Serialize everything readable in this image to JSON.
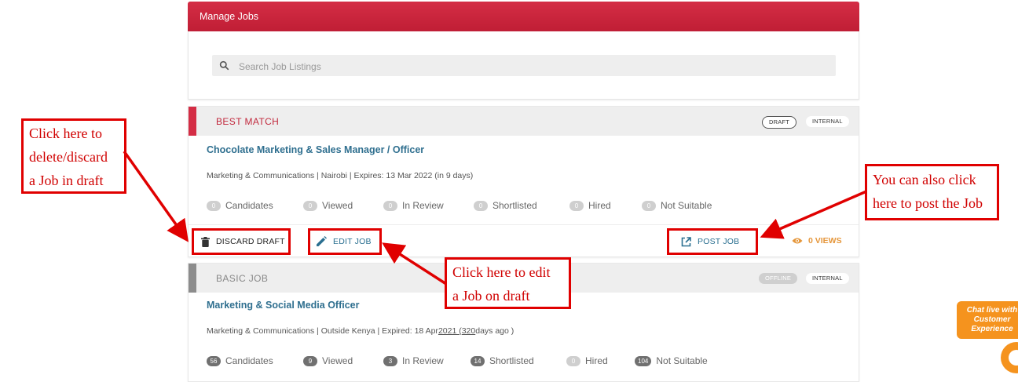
{
  "header": {
    "title": "Manage Jobs"
  },
  "search": {
    "placeholder": "Search Job Listings"
  },
  "jobs": [
    {
      "type": "BEST MATCH",
      "tags": [
        "DRAFT",
        "INTERNAL"
      ],
      "title": "Chocolate Marketing & Sales Manager / Officer",
      "meta": "Marketing & Communications | Nairobi | Expires: 13 Mar 2022 (in 9 days)",
      "stats": [
        {
          "count": "0",
          "label": "Candidates"
        },
        {
          "count": "0",
          "label": "Viewed"
        },
        {
          "count": "0",
          "label": "In Review"
        },
        {
          "count": "0",
          "label": "Shortlisted"
        },
        {
          "count": "0",
          "label": "Hired"
        },
        {
          "count": "0",
          "label": "Not Suitable"
        }
      ],
      "actions": {
        "discard": "DISCARD DRAFT",
        "edit": "EDIT JOB",
        "post": "POST JOB",
        "views": "0 VIEWS"
      }
    },
    {
      "type": "BASIC JOB",
      "tags": [
        "OFFLINE",
        "INTERNAL"
      ],
      "title": "Marketing & Social Media Officer",
      "meta_prefix": "Marketing & Communications | Outside Kenya | Expired: 18 Apr",
      "meta_link": "2021 (320",
      "meta_suffix": "days ago )",
      "stats": [
        {
          "count": "56",
          "label": "Candidates"
        },
        {
          "count": "9",
          "label": "Viewed"
        },
        {
          "count": "3",
          "label": "In Review"
        },
        {
          "count": "14",
          "label": "Shortlisted"
        },
        {
          "count": "0",
          "label": "Hired"
        },
        {
          "count": "104",
          "label": "Not Suitable"
        }
      ]
    }
  ],
  "annotations": {
    "discard": [
      "Click here to",
      "delete/discard",
      "a Job in draft"
    ],
    "edit": [
      "Click here to edit",
      "a Job on draft"
    ],
    "post": [
      "You can also click",
      "here to post the Job"
    ]
  },
  "chat": {
    "text": [
      "Chat live with",
      "Customer",
      "Experience"
    ]
  },
  "colors": {
    "brand": "#c8223a",
    "link": "#2f6f8f",
    "views": "#e5963a",
    "annotation": "#e00000",
    "chat": "#f5931e"
  }
}
